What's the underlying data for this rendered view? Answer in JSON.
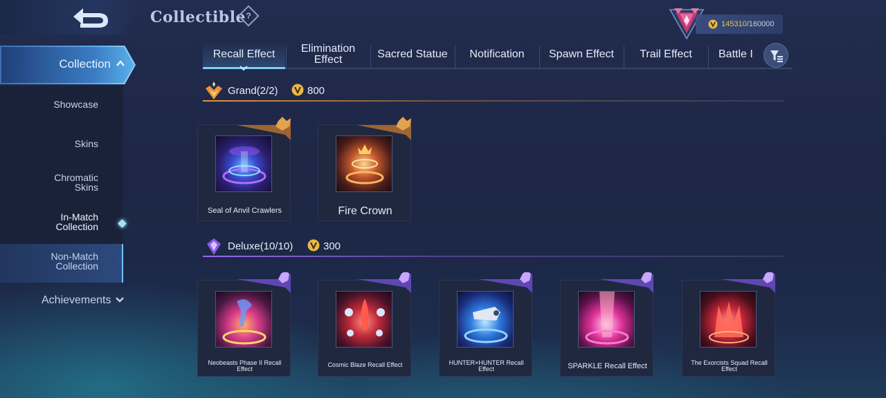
{
  "header": {
    "title": "Collectible",
    "points_current": "145310",
    "points_max": "/160000",
    "accent_gold": "#f2c14e"
  },
  "sidebar": {
    "section_label": "Collection",
    "items": [
      {
        "label_line1": "Showcase",
        "label_line2": ""
      },
      {
        "label_line1": "Skins",
        "label_line2": ""
      },
      {
        "label_line1": "Chromatic",
        "label_line2": "Skins"
      },
      {
        "label_line1": "In-Match",
        "label_line2": "Collection"
      },
      {
        "label_line1": "Non-Match",
        "label_line2": "Collection"
      }
    ],
    "active_index": 3,
    "achievements_label": "Achievements"
  },
  "tabs": [
    {
      "line1": "Recall Effect",
      "line2": ""
    },
    {
      "line1": "Elimination",
      "line2": "Effect"
    },
    {
      "line1": "Sacred Statue",
      "line2": ""
    },
    {
      "line1": "Notification",
      "line2": ""
    },
    {
      "line1": "Spawn Effect",
      "line2": ""
    },
    {
      "line1": "Trail Effect",
      "line2": ""
    },
    {
      "line1": "Battle I",
      "line2": ""
    }
  ],
  "sections": {
    "grand": {
      "title": "Grand(2/2)",
      "price": "800",
      "color": "#e8933a",
      "items": [
        {
          "name": "Seal of Anvil Crawlers",
          "icon": "anvil-crawlers-recall-art"
        },
        {
          "name": "Fire Crown",
          "icon": "fire-crown-recall-art"
        }
      ]
    },
    "deluxe": {
      "title": "Deluxe(10/10)",
      "price": "300",
      "color": "#9a6cf0",
      "items": [
        {
          "name_line1": "Neobeasts Phase II Recall",
          "name_line2": "Effect",
          "icon": "neobeasts-recall-art"
        },
        {
          "name_line1": "Cosmic Blaze Recall Effect",
          "name_line2": "",
          "icon": "cosmic-blaze-recall-art"
        },
        {
          "name_line1": "HUNTER×HUNTER Recall",
          "name_line2": "Effect",
          "icon": "hunter-hunter-recall-art"
        },
        {
          "name_line1": "SPARKLE Recall Effect",
          "name_line2": "",
          "icon": "sparkle-recall-art"
        },
        {
          "name_line1": "The Exorcists Squad Recall",
          "name_line2": "Effect",
          "icon": "exorcists-recall-art"
        }
      ]
    }
  }
}
